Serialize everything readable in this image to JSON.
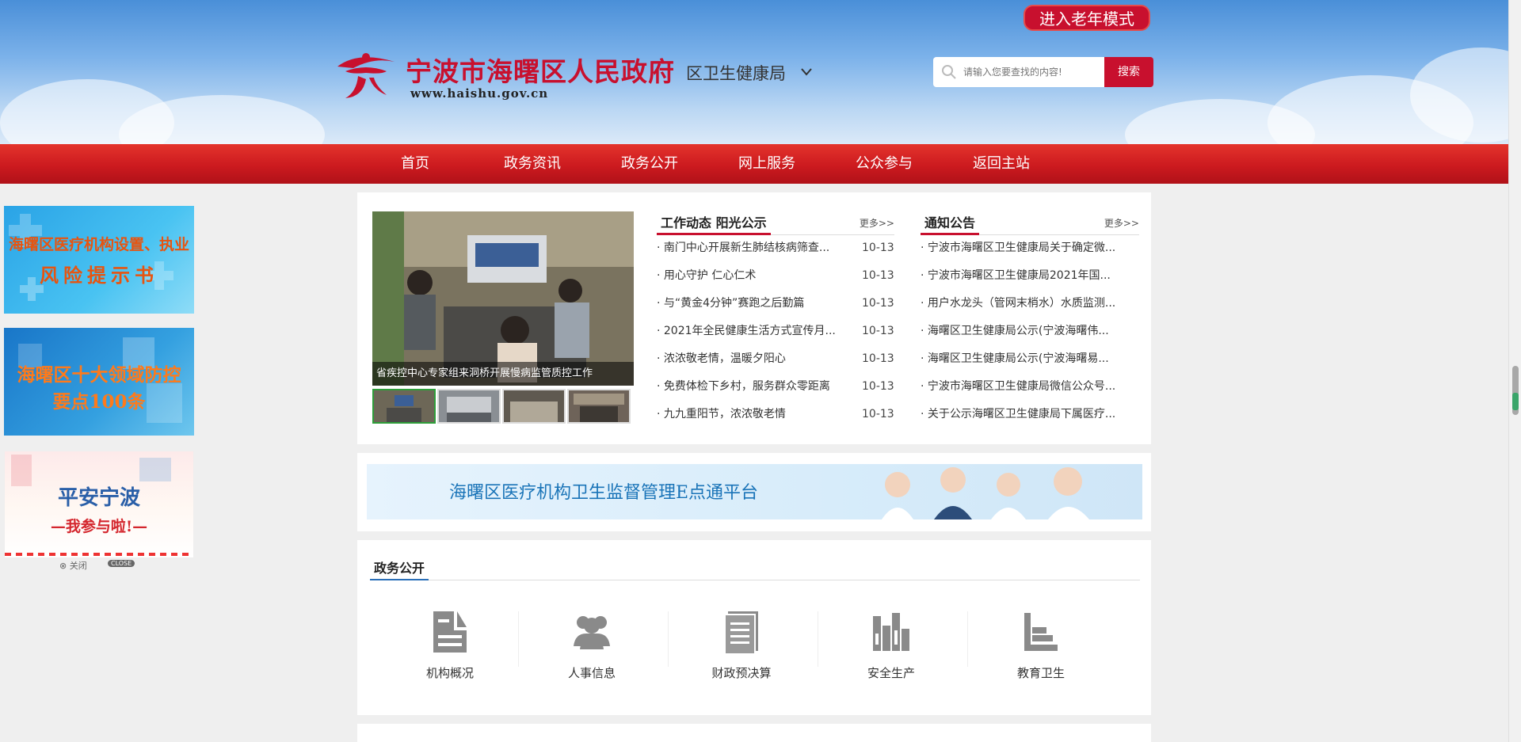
{
  "header": {
    "elder_mode": "进入老年模式",
    "site_title": "宁波市海曙区人民政府",
    "site_url": "www.haishu.gov.cn",
    "department": "区卫生健康局",
    "search_placeholder": "请输入您要查找的内容!",
    "search_button": "搜索"
  },
  "nav": [
    {
      "label": "首页"
    },
    {
      "label": "政务资讯"
    },
    {
      "label": "政务公开"
    },
    {
      "label": "网上服务"
    },
    {
      "label": "公众参与"
    },
    {
      "label": "返回主站"
    }
  ],
  "left_ads": {
    "ad1_line1": "海曙区医疗机构设置、执业",
    "ad1_line2": "风险提示书",
    "ad2_line1": "海曙区十大领域防控",
    "ad2_line2": "要点100条",
    "ad3_line1": "平安宁波",
    "ad3_line2": "—我参与啦!—",
    "close_cn": "⊗ 关闭",
    "close_en": "CLOSE"
  },
  "slider": {
    "caption": "省疾控中心专家组来洞桥开展慢病监管质控工作"
  },
  "work_news": {
    "title": "工作动态  阳光公示",
    "more": "更多>>",
    "items": [
      {
        "title": "· 南门中心开展新生肺结核病筛查...",
        "date": "10-13"
      },
      {
        "title": "· 用心守护 仁心仁术",
        "date": "10-13"
      },
      {
        "title": "· 与“黄金4分钟”赛跑之后勤篇",
        "date": "10-13"
      },
      {
        "title": "· 2021年全民健康生活方式宣传月...",
        "date": "10-13"
      },
      {
        "title": "· 浓浓敬老情，温暖夕阳心",
        "date": "10-13"
      },
      {
        "title": "· 免费体检下乡村，服务群众零距离",
        "date": "10-13"
      },
      {
        "title": "· 九九重阳节，浓浓敬老情",
        "date": "10-13"
      }
    ]
  },
  "notices": {
    "title": "通知公告",
    "more": "更多>>",
    "items": [
      {
        "title": "· 宁波市海曙区卫生健康局关于确定微..."
      },
      {
        "title": "· 宁波市海曙区卫生健康局2021年国..."
      },
      {
        "title": "· 用户水龙头（管网末梢水）水质监测..."
      },
      {
        "title": "· 海曙区卫生健康局公示(宁波海曙伟..."
      },
      {
        "title": "· 海曙区卫生健康局公示(宁波海曙易..."
      },
      {
        "title": "· 宁波市海曙区卫生健康局微信公众号..."
      },
      {
        "title": "· 关于公示海曙区卫生健康局下属医疗..."
      }
    ]
  },
  "banner": {
    "text": "海曙区医疗机构卫生监督管理E点通平台"
  },
  "gov_open": {
    "title": "政务公开",
    "categories": [
      {
        "label": "机构概况",
        "icon": "document-icon"
      },
      {
        "label": "人事信息",
        "icon": "people-icon"
      },
      {
        "label": "财政预决算",
        "icon": "ledger-icon"
      },
      {
        "label": "安全生产",
        "icon": "bar-chart-icon"
      },
      {
        "label": "教育卫生",
        "icon": "stacked-bars-icon"
      }
    ]
  },
  "colors": {
    "brand_red": "#c8102e",
    "nav_red": "#cc1a1f",
    "accent_blue": "#2a6fb8",
    "icon_gray": "#8a8a8a"
  }
}
